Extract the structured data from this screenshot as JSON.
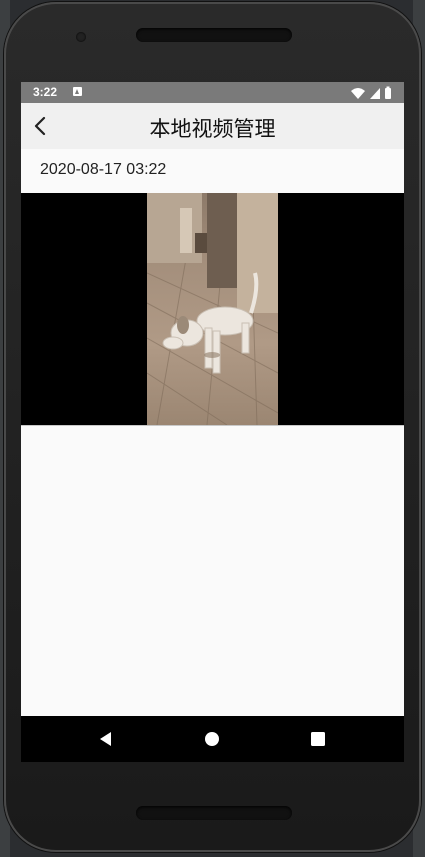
{
  "status_bar": {
    "time": "3:22",
    "notification_icon": "a-app-icon",
    "right_icons": [
      "wifi-icon",
      "signal-icon",
      "battery-icon"
    ]
  },
  "app_bar": {
    "title": "本地视频管理",
    "back_icon": "back-arrow-icon"
  },
  "recording": {
    "date": "2020-08-17 03:22",
    "thumbnail": "video-thumbnail-dog"
  },
  "nav_bar": {
    "icons": [
      "back-triangle-icon",
      "home-circle-icon",
      "recents-square-icon"
    ]
  },
  "colors": {
    "status_bar_bg": "#7a7a7a",
    "app_bar_bg": "#f0f0f0",
    "content_bg": "#fafafa",
    "video_bg": "#000000",
    "nav_bar_bg": "#000000"
  }
}
